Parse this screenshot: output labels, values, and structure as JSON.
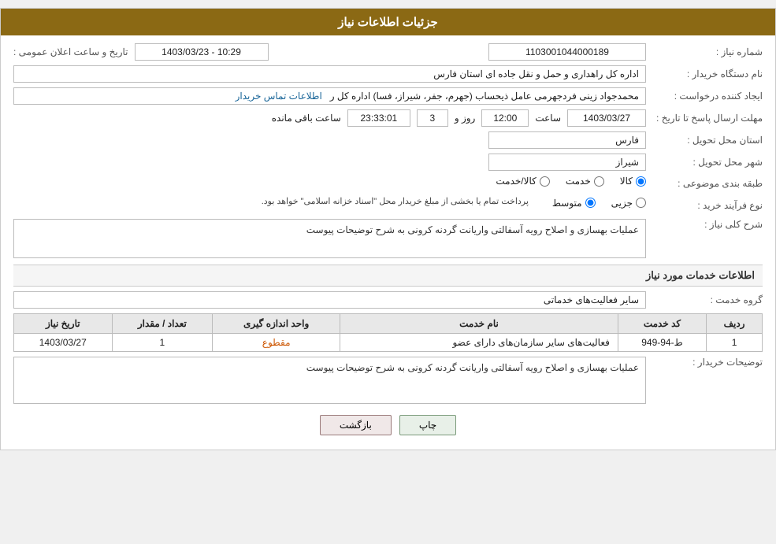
{
  "header": {
    "title": "جزئیات اطلاعات نیاز"
  },
  "fields": {
    "need_number_label": "شماره نیاز :",
    "need_number_value": "1103001044000189",
    "org_name_label": "نام دستگاه خریدار :",
    "org_name_value": "اداره کل راهداری و حمل و نقل جاده ای استان فارس",
    "requester_label": "ایجاد کننده درخواست :",
    "requester_value": "محمدجواد زینی فردجهرمی عامل ذیحساب (جهرم، جفر، شیراز، فسا) اداره کل ر",
    "requester_link": "اطلاعات تماس خریدار",
    "deadline_label": "مهلت ارسال پاسخ تا تاریخ :",
    "deadline_date": "1403/03/27",
    "deadline_time": "12:00",
    "deadline_days": "3",
    "deadline_countdown": "23:33:01",
    "deadline_remaining": "ساعت باقی مانده",
    "deadline_days_label": "روز و",
    "deadline_time_label": "ساعت",
    "province_label": "استان محل تحویل :",
    "province_value": "فارس",
    "city_label": "شهر محل تحویل :",
    "city_value": "شیراز",
    "category_label": "طبقه بندی موضوعی :",
    "category_options": [
      "کالا",
      "خدمت",
      "کالا/خدمت"
    ],
    "category_selected": "کالا",
    "purchase_type_label": "نوع فرآیند خرید :",
    "purchase_options": [
      "جزیی",
      "متوسط"
    ],
    "purchase_note": "پرداخت تمام یا بخشی از مبلغ خریدار محل \"اسناد خزانه اسلامی\" خواهد بود.",
    "need_description_label": "شرح کلی نیاز :",
    "need_description_value": "عملیات بهسازی و اصلاح رویه آسفالتی واریانت گردنه کرونی به شرح توضیحات پیوست"
  },
  "services_section": {
    "title": "اطلاعات خدمات مورد نیاز",
    "service_group_label": "گروه خدمت :",
    "service_group_value": "سایر فعالیت‌های خدماتی"
  },
  "table": {
    "headers": [
      "ردیف",
      "کد خدمت",
      "نام خدمت",
      "واحد اندازه گیری",
      "تعداد / مقدار",
      "تاریخ نیاز"
    ],
    "rows": [
      {
        "row": "1",
        "code": "ط-94-949",
        "name": "فعالیت‌های سایر سازمان‌های دارای عضو",
        "unit": "مقطوع",
        "quantity": "1",
        "date": "1403/03/27"
      }
    ]
  },
  "buyer_description_label": "توضیحات خریدار :",
  "buyer_description_value": "عملیات بهسازی و اصلاح رویه آسفالتی واریانت گردنه کرونی به شرح توضیحات پیوست",
  "buttons": {
    "print_label": "چاپ",
    "back_label": "بازگشت"
  },
  "date_announce_label": "تاریخ و ساعت اعلان عمومی :",
  "date_announce_value": "1403/03/23 - 10:29"
}
